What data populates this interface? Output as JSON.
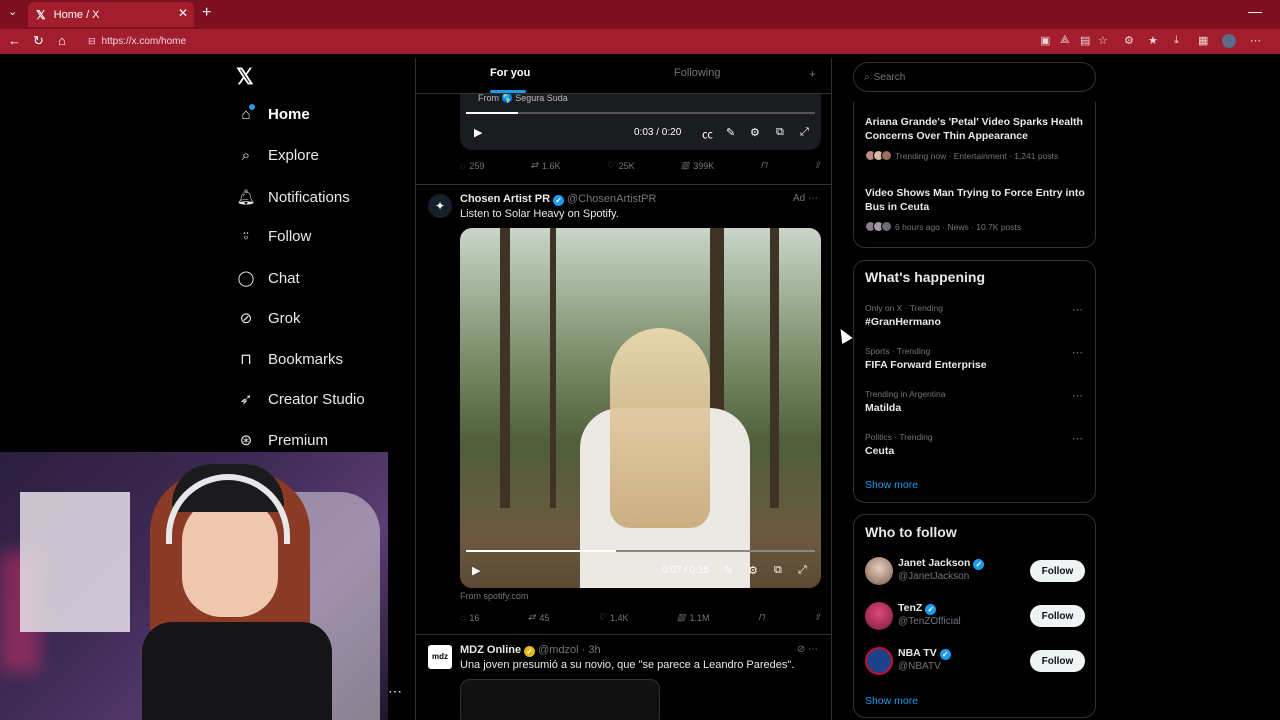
{
  "browser": {
    "tab_title": "Home / X",
    "url": "https://x.com/home"
  },
  "nav": {
    "items": [
      {
        "label": "Home",
        "icon": "home-icon"
      },
      {
        "label": "Explore",
        "icon": "search-icon"
      },
      {
        "label": "Notifications",
        "icon": "bell-icon"
      },
      {
        "label": "Follow",
        "icon": "person-plus-icon"
      },
      {
        "label": "Chat",
        "icon": "chat-icon"
      },
      {
        "label": "Grok",
        "icon": "grok-icon"
      },
      {
        "label": "Bookmarks",
        "icon": "bookmark-icon"
      },
      {
        "label": "Creator Studio",
        "icon": "rocket-icon"
      },
      {
        "label": "Premium",
        "icon": "premium-icon"
      }
    ]
  },
  "feed": {
    "tabs": {
      "for_you": "For you",
      "following": "Following"
    },
    "video1": {
      "from": "From 🌎 Segura Suda",
      "time": "0:03 / 0:20",
      "progress": 0.15,
      "replies": "259",
      "reposts": "1.6K",
      "likes": "25K",
      "views": "399K"
    },
    "post_ad": {
      "name": "Chosen Artist PR",
      "handle": "@ChosenArtistPR",
      "ad_label": "Ad",
      "text": "Listen to Solar Heavy on Spotify.",
      "time": "0:07 / 0:15",
      "progress": 0.43,
      "source": "From spotify.com",
      "replies": "16",
      "reposts": "45",
      "likes": "1.4K",
      "views": "1.1M"
    },
    "post_mdz": {
      "name": "MDZ Online",
      "handle": "@mdzol · 3h",
      "avatar_text": "mdz",
      "text": "Una joven presumió a su novio, que \"se parece a Leandro Paredes\"."
    }
  },
  "sidebar": {
    "search_placeholder": "Search",
    "news": [
      {
        "title": "Ariana Grande's 'Petal' Video Sparks Health Concerns Over Thin Appearance",
        "meta": "Trending now · Entertainment · 1,241 posts"
      },
      {
        "title": "Video Shows Man Trying to Force Entry into Bus in Ceuta",
        "meta": "6 hours ago · News · 10.7K posts"
      }
    ],
    "happening": {
      "title": "What's happening",
      "trends": [
        {
          "meta": "Only on X · Trending",
          "name": "#GranHermano"
        },
        {
          "meta": "Sports · Trending",
          "name": "FIFA Forward Enterprise"
        },
        {
          "meta": "Trending in Argentina",
          "name": "Matilda"
        },
        {
          "meta": "Politics · Trending",
          "name": "Ceuta"
        }
      ],
      "show_more": "Show more"
    },
    "who_to_follow": {
      "title": "Who to follow",
      "accounts": [
        {
          "name": "Janet Jackson",
          "handle": "@JanetJackson",
          "button": "Follow"
        },
        {
          "name": "TenZ",
          "handle": "@TenZOfficial",
          "button": "Follow"
        },
        {
          "name": "NBA TV",
          "handle": "@NBATV",
          "button": "Follow"
        }
      ],
      "show_more": "Show more"
    }
  },
  "colors": {
    "accent": "#1d9bf0",
    "browser_chrome": "#a21d2e",
    "background": "#000000"
  }
}
